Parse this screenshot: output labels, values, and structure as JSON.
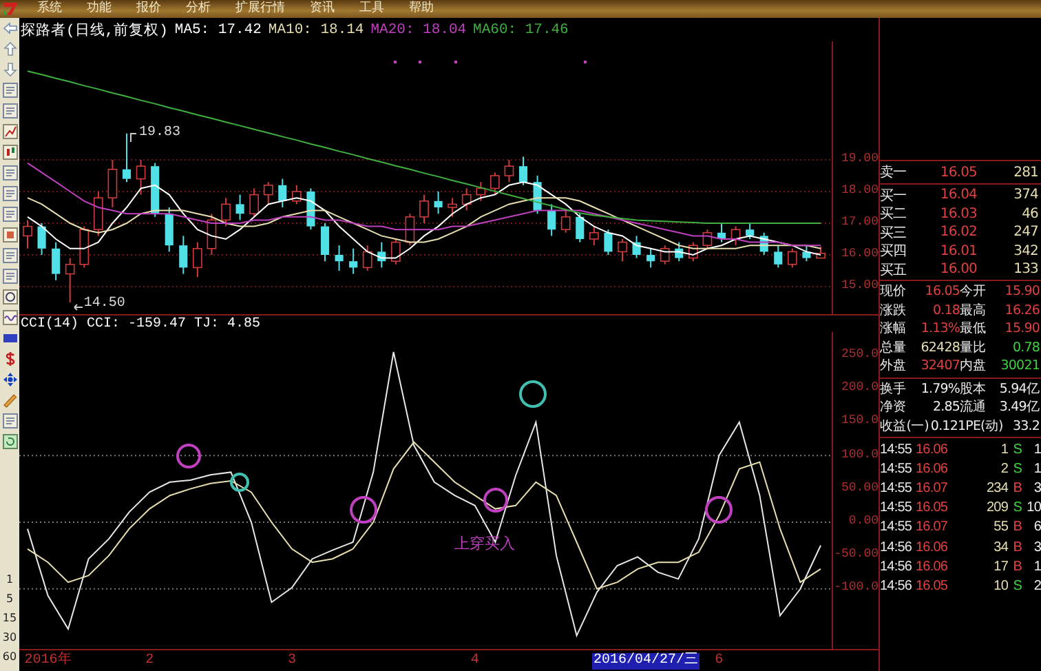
{
  "menu": {
    "items": [
      "系统",
      "功能",
      "报价",
      "分析",
      "扩展行情",
      "资讯",
      "工具",
      "帮助"
    ]
  },
  "title": {
    "name": "探路者(日线,前复权)",
    "indicators": [
      {
        "label": "MA5: 17.42",
        "color": "#ffffff"
      },
      {
        "label": "MA10: 18.14",
        "color": "#e8dfb0"
      },
      {
        "label": "MA20: 18.04",
        "color": "#c040c0"
      },
      {
        "label": "MA60: 17.46",
        "color": "#40b040"
      }
    ]
  },
  "toolbar": {
    "periods": [
      "1",
      "5",
      "15",
      "30",
      "60"
    ]
  },
  "price_chart": {
    "high_label": "19.83",
    "low_label": "14.50",
    "chart_data": {
      "type": "candlestick",
      "grid": true,
      "categories": [
        null,
        null,
        null,
        null,
        null,
        null,
        null,
        null,
        null,
        null,
        null,
        null,
        null,
        null,
        null,
        null,
        null,
        null,
        null,
        null,
        null,
        null,
        null,
        null,
        null,
        null,
        null,
        null,
        null,
        null,
        null,
        null,
        null,
        null,
        null,
        null,
        null,
        null,
        null,
        null,
        null,
        null,
        null,
        null,
        null,
        null,
        null,
        null,
        null,
        null,
        null,
        null,
        null,
        null,
        null,
        null,
        null
      ],
      "ylim": [
        14.13,
        22.74
      ],
      "ohlc": [
        [
          16.6,
          17.1,
          16.2,
          16.9
        ],
        [
          16.9,
          17.0,
          16.0,
          16.2
        ],
        [
          16.2,
          16.4,
          15.2,
          15.4
        ],
        [
          15.4,
          15.9,
          14.5,
          15.7
        ],
        [
          15.7,
          16.9,
          15.6,
          16.8
        ],
        [
          16.8,
          18.0,
          16.6,
          17.8
        ],
        [
          17.8,
          19.0,
          17.5,
          18.7
        ],
        [
          18.7,
          19.83,
          18.3,
          18.4
        ],
        [
          18.4,
          19.0,
          17.9,
          18.8
        ],
        [
          18.8,
          18.9,
          17.2,
          17.3
        ],
        [
          17.3,
          17.5,
          16.1,
          16.3
        ],
        [
          16.3,
          16.6,
          15.4,
          15.6
        ],
        [
          15.6,
          16.4,
          15.3,
          16.2
        ],
        [
          16.2,
          17.3,
          16.0,
          17.1
        ],
        [
          17.1,
          17.8,
          16.9,
          17.6
        ],
        [
          17.6,
          17.9,
          17.1,
          17.3
        ],
        [
          17.3,
          18.1,
          17.2,
          17.9
        ],
        [
          17.9,
          18.3,
          17.6,
          18.2
        ],
        [
          18.2,
          18.4,
          17.5,
          17.7
        ],
        [
          17.7,
          18.2,
          17.6,
          18.0
        ],
        [
          18.0,
          18.1,
          16.8,
          16.9
        ],
        [
          16.9,
          17.0,
          15.8,
          16.0
        ],
        [
          16.0,
          16.3,
          15.5,
          15.8
        ],
        [
          15.8,
          16.2,
          15.4,
          15.6
        ],
        [
          15.6,
          16.3,
          15.5,
          16.1
        ],
        [
          16.1,
          16.4,
          15.6,
          15.8
        ],
        [
          15.8,
          16.5,
          15.7,
          16.4
        ],
        [
          16.4,
          17.3,
          16.3,
          17.2
        ],
        [
          17.2,
          17.9,
          17.0,
          17.7
        ],
        [
          17.7,
          18.0,
          17.3,
          17.5
        ],
        [
          17.5,
          17.8,
          17.2,
          17.6
        ],
        [
          17.6,
          18.1,
          17.4,
          17.9
        ],
        [
          17.9,
          18.3,
          17.7,
          18.1
        ],
        [
          18.1,
          18.6,
          17.9,
          18.5
        ],
        [
          18.5,
          19.0,
          18.3,
          18.8
        ],
        [
          18.8,
          19.1,
          18.2,
          18.3
        ],
        [
          18.3,
          18.5,
          17.3,
          17.4
        ],
        [
          17.4,
          17.6,
          16.6,
          16.8
        ],
        [
          16.8,
          17.4,
          16.7,
          17.2
        ],
        [
          17.2,
          17.3,
          16.4,
          16.5
        ],
        [
          16.5,
          16.9,
          16.3,
          16.7
        ],
        [
          16.7,
          16.8,
          16.0,
          16.1
        ],
        [
          16.1,
          16.5,
          15.8,
          16.4
        ],
        [
          16.4,
          16.6,
          15.9,
          16.0
        ],
        [
          16.0,
          16.2,
          15.6,
          15.8
        ],
        [
          15.8,
          16.3,
          15.7,
          16.2
        ],
        [
          16.2,
          16.4,
          15.8,
          15.9
        ],
        [
          15.9,
          16.4,
          15.8,
          16.3
        ],
        [
          16.3,
          16.8,
          16.2,
          16.7
        ],
        [
          16.7,
          17.0,
          16.4,
          16.5
        ],
        [
          16.5,
          16.9,
          16.3,
          16.8
        ],
        [
          16.8,
          17.0,
          16.5,
          16.6
        ],
        [
          16.6,
          16.7,
          16.0,
          16.1
        ],
        [
          16.1,
          16.3,
          15.6,
          15.7
        ],
        [
          15.7,
          16.2,
          15.6,
          16.1
        ],
        [
          16.1,
          16.3,
          15.8,
          15.9
        ],
        [
          15.9,
          16.26,
          15.9,
          16.05
        ]
      ],
      "yticks": [
        {
          "value": 19,
          "label": "19.00"
        },
        {
          "value": 18,
          "label": "18.00"
        },
        {
          "value": 17,
          "label": "17.00"
        },
        {
          "value": 16,
          "label": "16.00"
        },
        {
          "value": 15,
          "label": "15.00"
        }
      ],
      "series": [
        {
          "type": "line",
          "color": "#ffffff",
          "values": [
            17.2,
            16.9,
            16.5,
            16.2,
            16.2,
            16.4,
            17.0,
            17.5,
            18.1,
            18.2,
            17.9,
            17.3,
            16.8,
            16.6,
            16.5,
            16.8,
            17.2,
            17.6,
            17.7,
            17.8,
            17.7,
            17.4,
            16.9,
            16.5,
            16.1,
            15.9,
            15.9,
            16.2,
            16.6,
            16.9,
            17.3,
            17.6,
            17.8,
            17.9,
            18.2,
            18.3,
            18.2,
            17.9,
            17.6,
            17.2,
            16.9,
            16.7,
            16.6,
            16.3,
            16.2,
            16.1,
            16.1,
            16.0,
            16.2,
            16.3,
            16.5,
            16.6,
            16.5,
            16.4,
            16.3,
            16.1,
            16.0
          ]
        },
        {
          "type": "line",
          "color": "#e8dfb0",
          "values": [
            17.8,
            17.6,
            17.3,
            17.0,
            16.8,
            16.7,
            16.8,
            17.0,
            17.3,
            17.4,
            17.4,
            17.4,
            17.3,
            17.2,
            17.0,
            16.9,
            16.9,
            17.0,
            17.2,
            17.3,
            17.4,
            17.4,
            17.2,
            17.0,
            16.8,
            16.6,
            16.5,
            16.4,
            16.4,
            16.5,
            16.7,
            16.9,
            17.2,
            17.4,
            17.6,
            17.7,
            17.8,
            17.8,
            17.8,
            17.7,
            17.5,
            17.3,
            17.1,
            16.9,
            16.7,
            16.5,
            16.3,
            16.2,
            16.2,
            16.2,
            16.2,
            16.3,
            16.3,
            16.3,
            16.3,
            16.3,
            16.2
          ]
        },
        {
          "type": "line",
          "color": "#c040c0",
          "values": [
            18.9,
            18.6,
            18.3,
            18.0,
            17.7,
            17.5,
            17.4,
            17.3,
            17.3,
            17.3,
            17.3,
            17.2,
            17.1,
            17.0,
            17.0,
            17.0,
            17.1,
            17.1,
            17.2,
            17.2,
            17.2,
            17.1,
            17.1,
            17.0,
            16.9,
            16.9,
            16.8,
            16.8,
            16.8,
            16.8,
            16.9,
            16.9,
            17.0,
            17.1,
            17.2,
            17.3,
            17.4,
            17.4,
            17.4,
            17.4,
            17.3,
            17.2,
            17.1,
            17.0,
            16.9,
            16.8,
            16.7,
            16.6,
            16.6,
            16.5,
            16.5,
            16.4,
            16.4,
            16.4,
            16.3,
            16.3,
            16.3
          ]
        },
        {
          "type": "line",
          "color": "#40b040",
          "values": [
            21.8,
            21.69,
            21.57,
            21.46,
            21.34,
            21.23,
            21.11,
            21.0,
            20.88,
            20.77,
            20.65,
            20.54,
            20.42,
            20.31,
            20.19,
            20.08,
            19.96,
            19.85,
            19.73,
            19.62,
            19.5,
            19.39,
            19.27,
            19.16,
            19.04,
            18.93,
            18.81,
            18.7,
            18.58,
            18.47,
            18.35,
            18.24,
            18.12,
            18.01,
            17.89,
            17.78,
            17.66,
            17.55,
            17.43,
            17.32,
            17.25,
            17.2,
            17.15,
            17.1,
            17.08,
            17.06,
            17.04,
            17.02,
            17.0,
            17.0,
            17.0,
            17.0,
            17.0,
            17.0,
            17.0,
            17.0,
            17.0
          ]
        }
      ]
    }
  },
  "cci": {
    "header": "CCI(14) CCI: -159.47 TJ: 4.85",
    "annotation": "上穿买入",
    "cursor_date": "2016/04/27/三",
    "chart_data": {
      "type": "line",
      "grid": true,
      "categories": [
        null,
        "2016年",
        null,
        null,
        null,
        null,
        "2",
        null,
        null,
        null,
        null,
        null,
        null,
        "3",
        null,
        null,
        null,
        null,
        null,
        null,
        null,
        null,
        "4",
        null,
        null,
        null,
        null,
        null,
        null,
        null,
        null,
        null,
        null,
        null,
        "6",
        null,
        null,
        null,
        null,
        null
      ],
      "ylim": [
        -190,
        285
      ],
      "yticks": [
        {
          "value": 250,
          "label": "250.0"
        },
        {
          "value": 200,
          "label": "200.0"
        },
        {
          "value": 150,
          "label": "150.0"
        },
        {
          "value": 100,
          "label": "100.0"
        },
        {
          "value": 50,
          "label": "50.00"
        },
        {
          "value": 0,
          "label": "0.00"
        },
        {
          "value": -50,
          "label": "-50.00"
        },
        {
          "value": -100,
          "label": "-100.0"
        }
      ],
      "series": [
        {
          "color": "#e8e8e8",
          "values": [
            -10,
            -110,
            -160,
            -55,
            -25,
            15,
            45,
            60,
            63,
            71,
            75,
            0,
            -120,
            -98,
            -55,
            -42,
            -30,
            75,
            255,
            115,
            60,
            40,
            25,
            -30,
            70,
            150,
            -50,
            -170,
            -105,
            -65,
            -52,
            -75,
            -85,
            -25,
            100,
            150,
            40,
            -140,
            -100,
            -35
          ]
        },
        {
          "color": "#e8dfb0",
          "values": [
            -40,
            -60,
            -90,
            -80,
            -50,
            -10,
            20,
            40,
            50,
            58,
            62,
            45,
            0,
            -40,
            -60,
            -55,
            -40,
            0,
            80,
            120,
            90,
            60,
            40,
            20,
            25,
            60,
            40,
            -30,
            -100,
            -90,
            -70,
            -60,
            -60,
            -45,
            10,
            80,
            90,
            -10,
            -90,
            -70
          ]
        }
      ]
    }
  },
  "quote": {
    "asks": [
      {
        "label": "卖一",
        "price": "16.05",
        "volume": "281"
      }
    ],
    "bids": [
      {
        "label": "买一",
        "price": "16.04",
        "volume": "374"
      },
      {
        "label": "买二",
        "price": "16.03",
        "volume": "46"
      },
      {
        "label": "买三",
        "price": "16.02",
        "volume": "247"
      },
      {
        "label": "买四",
        "price": "16.01",
        "volume": "342"
      },
      {
        "label": "买五",
        "price": "16.00",
        "volume": "133"
      }
    ],
    "stat_groups": [
      [
        {
          "label": "现价",
          "value": "16.05",
          "label2": "今开",
          "value2": "15.90"
        },
        {
          "label": "涨跌",
          "value": "0.18",
          "label2": "最高",
          "value2": "16.26"
        },
        {
          "label": "涨幅",
          "value": "1.13%",
          "label2": "最低",
          "value2": "15.90"
        },
        {
          "label": "总量",
          "value": "62428",
          "label2": "量比",
          "value2": "0.78"
        },
        {
          "label": "外盘",
          "value": "32407",
          "label2": "内盘",
          "value2": "30021"
        }
      ],
      [
        {
          "label": "换手",
          "value": "1.79%",
          "label2": "股本",
          "value2": "5.94亿"
        },
        {
          "label": "净资",
          "value": "2.85",
          "label2": "流通",
          "value2": "3.49亿"
        },
        {
          "label": "收益(一)",
          "value": "0.121",
          "label2": "PE(动)",
          "value2": "33.2"
        }
      ]
    ],
    "ticks": [
      {
        "time": "14:55",
        "price": "16.06",
        "volume": "1",
        "side": "S",
        "kind": "sell",
        "column_5": "1"
      },
      {
        "time": "14:55",
        "price": "16.06",
        "volume": "2",
        "side": "S",
        "kind": "sell",
        "column_5": "1"
      },
      {
        "time": "14:55",
        "price": "16.07",
        "volume": "234",
        "side": "B",
        "kind": "buy",
        "column_5": "3"
      },
      {
        "time": "14:55",
        "price": "16.05",
        "volume": "209",
        "side": "S",
        "kind": "sell",
        "column_5": "10"
      },
      {
        "time": "14:55",
        "price": "16.07",
        "volume": "55",
        "side": "B",
        "kind": "buy",
        "column_5": "6"
      },
      {
        "time": "14:56",
        "price": "16.06",
        "volume": "34",
        "side": "B",
        "kind": "buy",
        "column_5": "3"
      },
      {
        "time": "14:56",
        "price": "16.06",
        "volume": "17",
        "side": "B",
        "kind": "buy",
        "column_5": "1"
      },
      {
        "time": "14:56",
        "price": "16.05",
        "volume": "10",
        "side": "S",
        "kind": "sell",
        "column_5": "2"
      }
    ]
  }
}
